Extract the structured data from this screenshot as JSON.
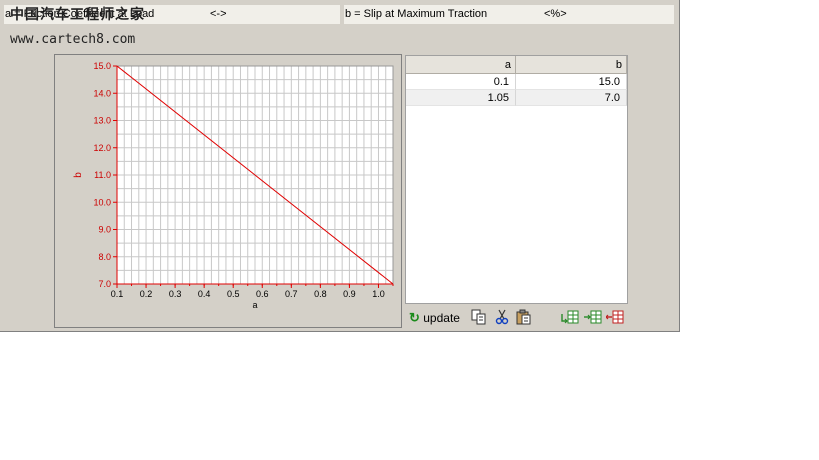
{
  "header": {
    "a_label": "a = Friction Coefficient at Load",
    "a_unit": "<->",
    "b_label": "b = Slip at Maximum Traction",
    "b_unit": "<%>"
  },
  "watermark": {
    "chinese": "中国汽车工程师之家",
    "url": "www.cartech8.com"
  },
  "table": {
    "columns": [
      "a",
      "b"
    ],
    "rows": [
      [
        "0.1",
        "15.0"
      ],
      [
        "1.05",
        "7.0"
      ]
    ]
  },
  "toolbar": {
    "update_label": "update",
    "icons": [
      "refresh-icon",
      "copy-icon",
      "cut-icon",
      "paste-icon",
      "insert-row-icon",
      "append-row-icon",
      "delete-row-icon"
    ]
  },
  "colors": {
    "line": "#e00000",
    "axis_text": "#cc0000",
    "grid": "#c8c8c8"
  },
  "chart_data": {
    "type": "line",
    "x": [
      0.1,
      1.05
    ],
    "series": [
      {
        "values": [
          15.0,
          7.0
        ]
      }
    ],
    "xlabel": "a",
    "ylabel": "b",
    "xlim": [
      0.1,
      1.05
    ],
    "ylim": [
      7.0,
      15.0
    ],
    "xticks": [
      "0.1",
      "0.2",
      "0.3",
      "0.4",
      "0.5",
      "0.6",
      "0.7",
      "0.8",
      "0.9",
      "1.0"
    ],
    "yticks": [
      "7.0",
      "8.0",
      "9.0",
      "10.0",
      "11.0",
      "12.0",
      "13.0",
      "14.0",
      "15.0"
    ],
    "grid": true
  }
}
